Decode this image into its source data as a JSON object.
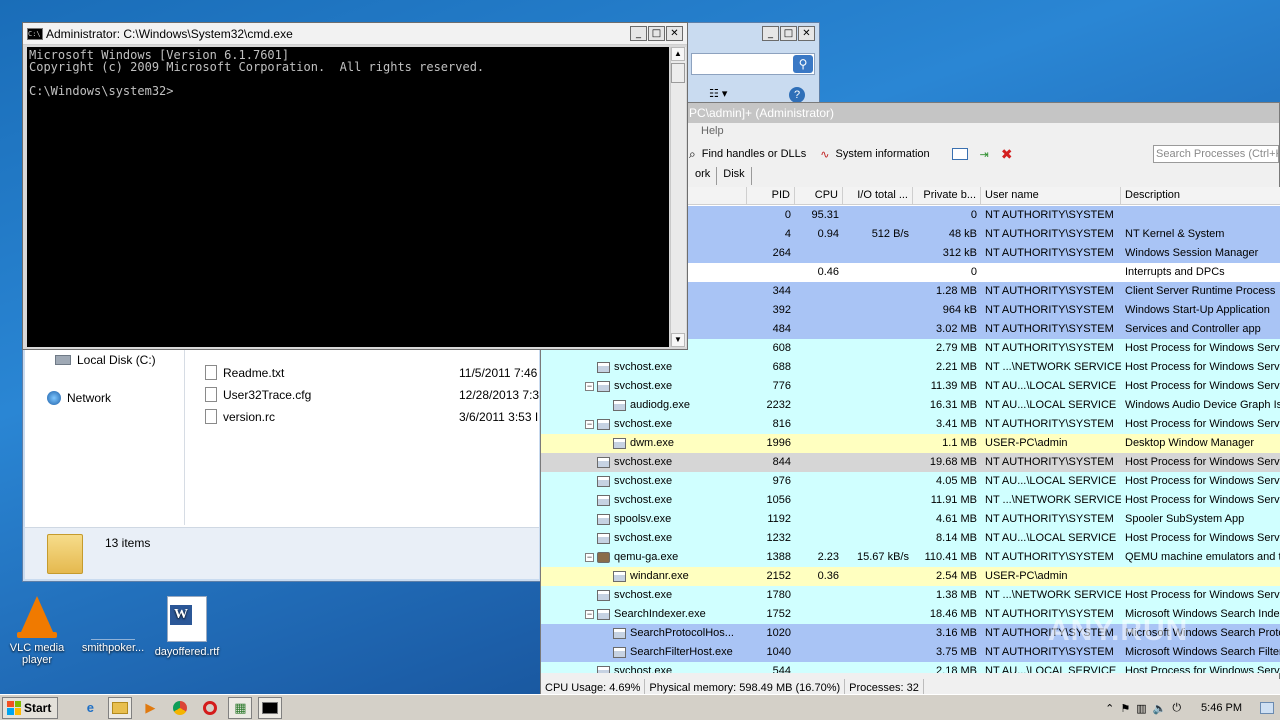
{
  "desktop": {
    "vlc_label": "VLC media player",
    "smith_label": "smithpoker...",
    "dayoffered_label": "dayoffered.rtf"
  },
  "explorer": {
    "nav": [
      {
        "label": "Local Disk (C:)"
      },
      {
        "label": "Network"
      }
    ],
    "files": [
      {
        "name": "Readme.txt",
        "date": "11/5/2011 7:46"
      },
      {
        "name": "User32Trace.cfg",
        "date": "12/28/2013 7:3"
      },
      {
        "name": "version.rc",
        "date": "3/6/2011 3:53 I"
      }
    ],
    "item_count": "13 items"
  },
  "cmd": {
    "title": "Administrator: C:\\Windows\\System32\\cmd.exe",
    "line1": "Microsoft Windows [Version 6.1.7601]",
    "line2": "Copyright (c) 2009 Microsoft Corporation.  All rights reserved.",
    "line3": "",
    "line4": "C:\\Windows\\system32>"
  },
  "procexp": {
    "title": "PC\\admin]+ (Administrator)",
    "menu_help": "Help",
    "toolbar": {
      "find_handles": "Find handles or DLLs",
      "system_info": "System information"
    },
    "search_placeholder": "Search Processes (Ctrl+K)",
    "tabs": [
      "ork",
      "Disk"
    ],
    "columns": {
      "pid": "PID",
      "cpu": "CPU",
      "io": "I/O total ...",
      "priv": "Private b...",
      "user": "User name",
      "desc": "Description"
    },
    "rows": [
      {
        "name": "",
        "indent": 0,
        "tog": "",
        "icon": false,
        "pid": "0",
        "cpu": "95.31",
        "io": "",
        "priv": "0",
        "user": "NT AUTHORITY\\SYSTEM",
        "desc": "",
        "bg": "#a9c4f5"
      },
      {
        "name": "",
        "indent": 0,
        "tog": "",
        "icon": false,
        "pid": "4",
        "cpu": "0.94",
        "io": "512 B/s",
        "priv": "48 kB",
        "user": "NT AUTHORITY\\SYSTEM",
        "desc": "NT Kernel & System",
        "bg": "#a9c4f5"
      },
      {
        "name": "",
        "indent": 0,
        "tog": "",
        "icon": false,
        "pid": "264",
        "cpu": "",
        "io": "",
        "priv": "312 kB",
        "user": "NT AUTHORITY\\SYSTEM",
        "desc": "Windows Session Manager",
        "bg": "#a9c4f5"
      },
      {
        "name": "",
        "indent": 0,
        "tog": "",
        "icon": false,
        "pid": "",
        "cpu": "0.46",
        "io": "",
        "priv": "0",
        "user": "",
        "desc": "Interrupts and DPCs",
        "bg": "#ffffff"
      },
      {
        "name": "",
        "indent": 0,
        "tog": "",
        "icon": false,
        "pid": "344",
        "cpu": "",
        "io": "",
        "priv": "1.28 MB",
        "user": "NT AUTHORITY\\SYSTEM",
        "desc": "Client Server Runtime Process",
        "bg": "#a9c4f5"
      },
      {
        "name": "",
        "indent": 0,
        "tog": "",
        "icon": false,
        "pid": "392",
        "cpu": "",
        "io": "",
        "priv": "964 kB",
        "user": "NT AUTHORITY\\SYSTEM",
        "desc": "Windows Start-Up Application",
        "bg": "#a9c4f5"
      },
      {
        "name": "",
        "indent": 0,
        "tog": "",
        "icon": false,
        "pid": "484",
        "cpu": "",
        "io": "",
        "priv": "3.02 MB",
        "user": "NT AUTHORITY\\SYSTEM",
        "desc": "Services and Controller app",
        "bg": "#a9c4f5"
      },
      {
        "name": "",
        "indent": 0,
        "tog": "",
        "icon": false,
        "pid": "608",
        "cpu": "",
        "io": "",
        "priv": "2.79 MB",
        "user": "NT AUTHORITY\\SYSTEM",
        "desc": "Host Process for Windows Servi",
        "bg": "#d0ffff"
      },
      {
        "name": "svchost.exe",
        "indent": 56,
        "tog": "",
        "icon": true,
        "pid": "688",
        "cpu": "",
        "io": "",
        "priv": "2.21 MB",
        "user": "NT ...\\NETWORK SERVICE",
        "desc": "Host Process for Windows Servi",
        "bg": "#d0ffff"
      },
      {
        "name": "svchost.exe",
        "indent": 44,
        "tog": "−",
        "icon": true,
        "pid": "776",
        "cpu": "",
        "io": "",
        "priv": "11.39 MB",
        "user": "NT AU...\\LOCAL SERVICE",
        "desc": "Host Process for Windows Servi",
        "bg": "#d0ffff"
      },
      {
        "name": "audiodg.exe",
        "indent": 72,
        "tog": "",
        "icon": true,
        "pid": "2232",
        "cpu": "",
        "io": "",
        "priv": "16.31 MB",
        "user": "NT AU...\\LOCAL SERVICE",
        "desc": "Windows Audio Device Graph Is",
        "bg": "#d0ffff"
      },
      {
        "name": "svchost.exe",
        "indent": 44,
        "tog": "−",
        "icon": true,
        "pid": "816",
        "cpu": "",
        "io": "",
        "priv": "3.41 MB",
        "user": "NT AUTHORITY\\SYSTEM",
        "desc": "Host Process for Windows Servi",
        "bg": "#d0ffff"
      },
      {
        "name": "dwm.exe",
        "indent": 72,
        "tog": "",
        "icon": true,
        "pid": "1996",
        "cpu": "",
        "io": "",
        "priv": "1.1 MB",
        "user": "USER-PC\\admin",
        "desc": "Desktop Window Manager",
        "bg": "#ffffc0"
      },
      {
        "name": "svchost.exe",
        "indent": 56,
        "tog": "",
        "icon": true,
        "pid": "844",
        "cpu": "",
        "io": "",
        "priv": "19.68 MB",
        "user": "NT AUTHORITY\\SYSTEM",
        "desc": "Host Process for Windows Servi",
        "bg": "#d6d6d6"
      },
      {
        "name": "svchost.exe",
        "indent": 56,
        "tog": "",
        "icon": true,
        "pid": "976",
        "cpu": "",
        "io": "",
        "priv": "4.05 MB",
        "user": "NT AU...\\LOCAL SERVICE",
        "desc": "Host Process for Windows Servi",
        "bg": "#d0ffff"
      },
      {
        "name": "svchost.exe",
        "indent": 56,
        "tog": "",
        "icon": true,
        "pid": "1056",
        "cpu": "",
        "io": "",
        "priv": "11.91 MB",
        "user": "NT ...\\NETWORK SERVICE",
        "desc": "Host Process for Windows Servi",
        "bg": "#d0ffff"
      },
      {
        "name": "spoolsv.exe",
        "indent": 56,
        "tog": "",
        "icon": true,
        "pid": "1192",
        "cpu": "",
        "io": "",
        "priv": "4.61 MB",
        "user": "NT AUTHORITY\\SYSTEM",
        "desc": "Spooler SubSystem App",
        "bg": "#d0ffff"
      },
      {
        "name": "svchost.exe",
        "indent": 56,
        "tog": "",
        "icon": true,
        "pid": "1232",
        "cpu": "",
        "io": "",
        "priv": "8.14 MB",
        "user": "NT AU...\\LOCAL SERVICE",
        "desc": "Host Process for Windows Servi",
        "bg": "#d0ffff"
      },
      {
        "name": "qemu-ga.exe",
        "indent": 44,
        "tog": "−",
        "icon": "qemu",
        "pid": "1388",
        "cpu": "2.23",
        "io": "15.67 kB/s",
        "priv": "110.41 MB",
        "user": "NT AUTHORITY\\SYSTEM",
        "desc": "QEMU machine emulators and to",
        "bg": "#d0ffff"
      },
      {
        "name": "windanr.exe",
        "indent": 72,
        "tog": "",
        "icon": true,
        "pid": "2152",
        "cpu": "0.36",
        "io": "",
        "priv": "2.54 MB",
        "user": "USER-PC\\admin",
        "desc": "",
        "bg": "#ffffc0"
      },
      {
        "name": "svchost.exe",
        "indent": 56,
        "tog": "",
        "icon": true,
        "pid": "1780",
        "cpu": "",
        "io": "",
        "priv": "1.38 MB",
        "user": "NT ...\\NETWORK SERVICE",
        "desc": "Host Process for Windows Servi",
        "bg": "#d0ffff"
      },
      {
        "name": "SearchIndexer.exe",
        "indent": 44,
        "tog": "−",
        "icon": true,
        "pid": "1752",
        "cpu": "",
        "io": "",
        "priv": "18.46 MB",
        "user": "NT AUTHORITY\\SYSTEM",
        "desc": "Microsoft Windows Search Index",
        "bg": "#d0ffff"
      },
      {
        "name": "SearchProtocolHos...",
        "indent": 72,
        "tog": "",
        "icon": true,
        "pid": "1020",
        "cpu": "",
        "io": "",
        "priv": "3.16 MB",
        "user": "NT AUTHORITY\\SYSTEM",
        "desc": "Microsoft Windows Search Proto",
        "bg": "#a9c4f5"
      },
      {
        "name": "SearchFilterHost.exe",
        "indent": 72,
        "tog": "",
        "icon": true,
        "pid": "1040",
        "cpu": "",
        "io": "",
        "priv": "3.75 MB",
        "user": "NT AUTHORITY\\SYSTEM",
        "desc": "Microsoft Windows Search Filter",
        "bg": "#a9c4f5"
      },
      {
        "name": "svchost.exe",
        "indent": 56,
        "tog": "",
        "icon": true,
        "pid": "544",
        "cpu": "",
        "io": "",
        "priv": "2.18 MB",
        "user": "NT AU...\\LOCAL SERVICE",
        "desc": "Host Process for Windows Servi",
        "bg": "#d0ffff"
      }
    ],
    "status": {
      "cpu": "CPU Usage: 4.69%",
      "mem": "Physical memory: 598.49 MB (16.70%)",
      "procs": "Processes: 32"
    }
  },
  "taskbar": {
    "start_label": "Start",
    "clock": "5:46 PM"
  },
  "watermark": "ANY.RUN"
}
